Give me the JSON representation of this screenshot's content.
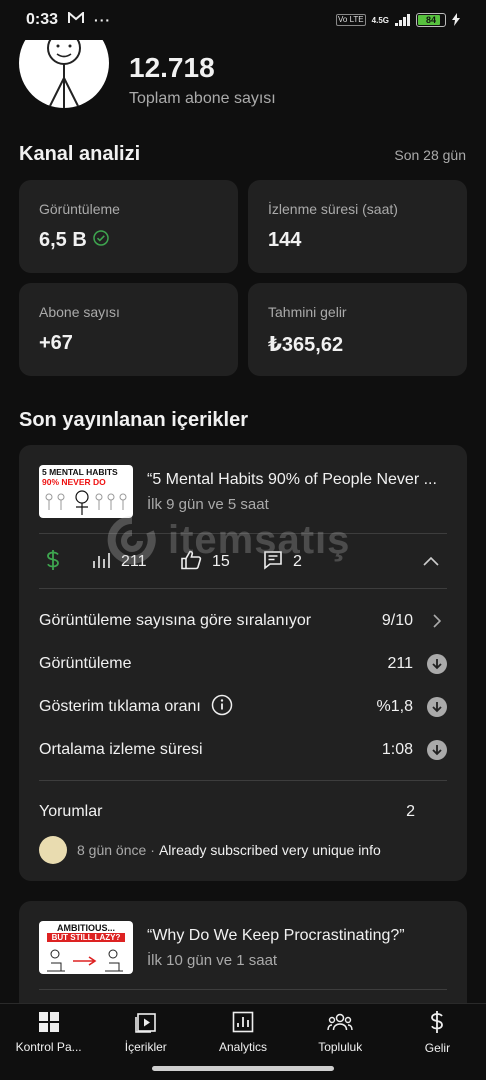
{
  "status_bar": {
    "time": "0:33",
    "volte": "Vo LTE",
    "network": "4.5G",
    "battery": "84",
    "battery_level": 0.84
  },
  "channel": {
    "subscriber_count": "12.718",
    "subscriber_label": "Toplam abone sayısı"
  },
  "analytics": {
    "title": "Kanal analizi",
    "period": "Son 28 gün",
    "cards": [
      {
        "label": "Görüntüleme",
        "value": "6,5 B"
      },
      {
        "label": "İzlenme süresi (saat)",
        "value": "144"
      },
      {
        "label": "Abone sayısı",
        "value": "+67"
      },
      {
        "label": "Tahmini gelir",
        "value": "₺365,62"
      }
    ]
  },
  "recent": {
    "title": "Son yayınlanan içerikler",
    "videos": [
      {
        "thumb_line1": "5 MENTAL HABITS",
        "thumb_line2": "90% NEVER DO",
        "title": "“5 Mental Habits 90% of People Never ...",
        "age": "İlk 9 gün ve 5 saat",
        "views": "211",
        "likes": "15",
        "comments": "2",
        "details": [
          {
            "label": "Görüntüleme sayısına göre sıralanıyor",
            "value": "9/10"
          },
          {
            "label": "Görüntüleme",
            "value": "211"
          },
          {
            "label": "Gösterim tıklama oranı",
            "value": "%1,8"
          },
          {
            "label": "Ortalama izleme süresi",
            "value": "1:08"
          }
        ],
        "comments_label": "Yorumlar",
        "comments_count": "2",
        "latest_comment_time": "8 gün önce",
        "latest_comment_sep": "·",
        "latest_comment_text": "Already subscribed very unique info"
      },
      {
        "thumb_line1": "AMBITIOUS...",
        "thumb_line2": "BUT STILL LAZY?",
        "title": "“Why Do We Keep Procrastinating?”",
        "age": "İlk 10 gün ve 1 saat"
      }
    ]
  },
  "watermark": {
    "text": "itemsatış"
  },
  "colors": {
    "accent_green": "#3ea64f",
    "card_bg": "#212121",
    "page_bg": "#0f0f0f"
  },
  "bottom_nav": [
    {
      "label": "Kontrol Pa...",
      "icon": "dashboard-icon"
    },
    {
      "label": "İçerikler",
      "icon": "content-icon"
    },
    {
      "label": "Analytics",
      "icon": "analytics-icon"
    },
    {
      "label": "Topluluk",
      "icon": "community-icon"
    },
    {
      "label": "Gelir",
      "icon": "dollar-icon"
    }
  ]
}
